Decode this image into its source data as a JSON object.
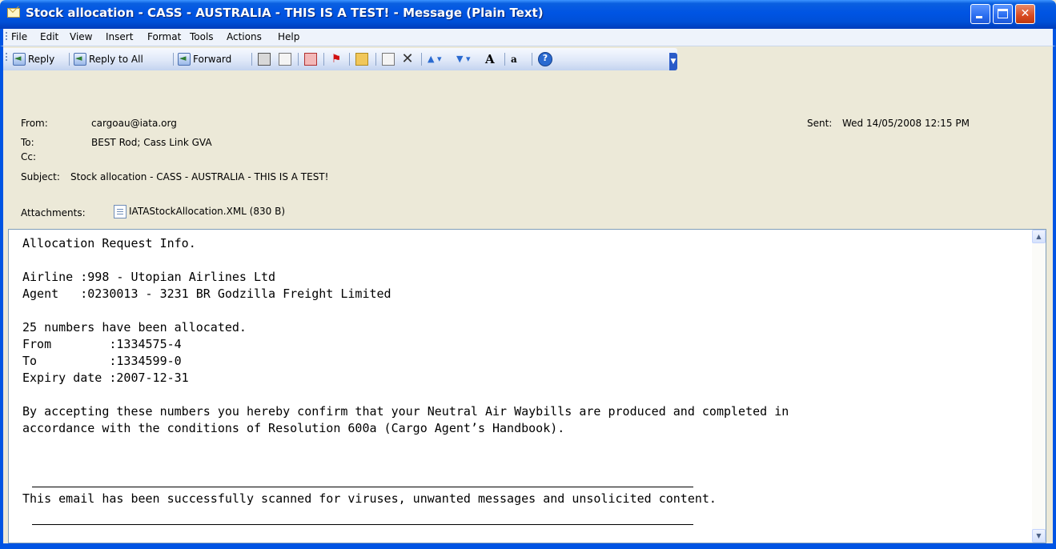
{
  "window": {
    "title": "Stock allocation - CASS - AUSTRALIA - THIS IS A TEST! - Message (Plain Text)"
  },
  "menu": [
    "File",
    "Edit",
    "View",
    "Insert",
    "Format",
    "Tools",
    "Actions",
    "Help"
  ],
  "toolbar": {
    "reply": "Reply",
    "reply_all": "Reply to All",
    "forward": "Forward",
    "icons": [
      "print-icon",
      "copy-icon",
      "move-to-folder-icon",
      "flag-icon",
      "folder-icon",
      "move-icon",
      "delete-icon",
      "previous-item-icon",
      "next-item-icon",
      "font-size-icon",
      "encoding-icon",
      "help-icon"
    ]
  },
  "header": {
    "from_label": "From:",
    "from": "cargoau@iata.org",
    "sent_label": "Sent:",
    "sent": "Wed 14/05/2008 12:15 PM",
    "to_label": "To:",
    "to": "BEST Rod; Cass Link GVA",
    "cc_label": "Cc:",
    "cc": "",
    "subject_label": "Subject:",
    "subject": "Stock allocation - CASS - AUSTRALIA - THIS IS A TEST!",
    "attachments_label": "Attachments:",
    "attachment": "IATAStockAllocation.XML (830 B)"
  },
  "body": {
    "lines": [
      "Allocation Request Info.",
      "",
      "Airline :998 - Utopian Airlines Ltd",
      "Agent   :0230013 - 3231 BR Godzilla Freight Limited",
      "",
      "25 numbers have been allocated.",
      "From        :1334575-4",
      "To          :1334599-0",
      "Expiry date :2007-12-31",
      "",
      "By accepting these numbers you hereby confirm that your Neutral Air Waybills are produced and completed in",
      "accordance with the conditions of Resolution 600a (Cargo Agent’s Handbook)."
    ],
    "footer": "This email has been successfully scanned for viruses, unwanted messages and unsolicited content."
  }
}
